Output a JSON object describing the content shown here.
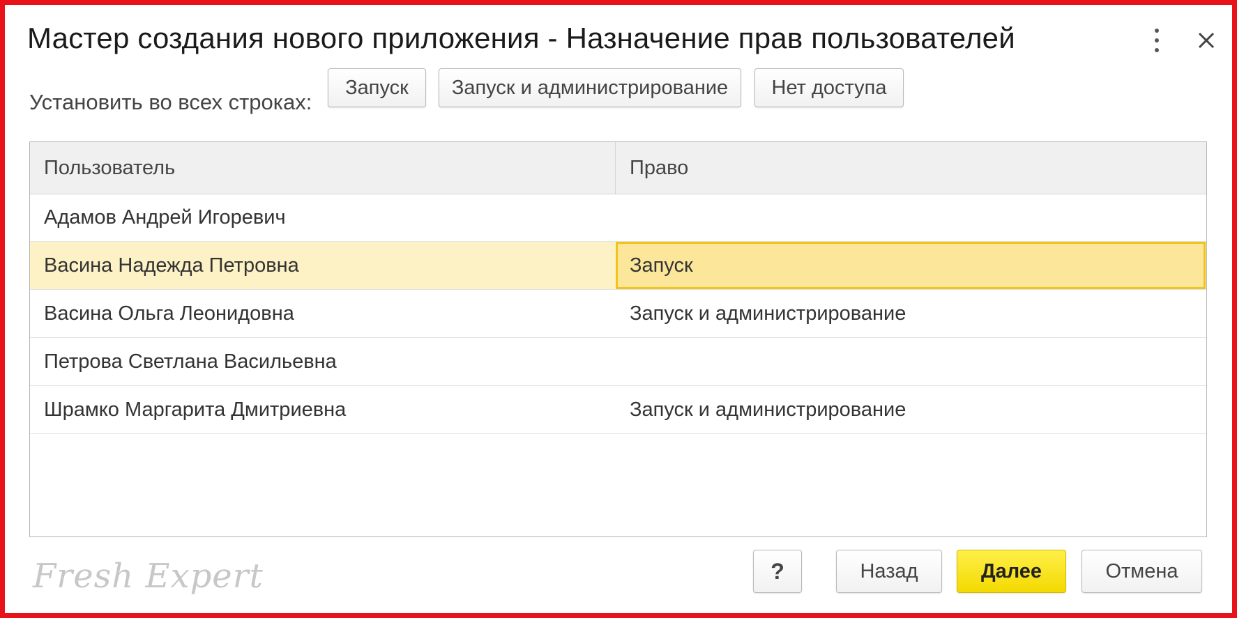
{
  "window": {
    "title": "Мастер создания нового приложения - Назначение прав пользователей",
    "more_icon": "vertical-dots-icon",
    "close_icon": "close-icon"
  },
  "toolbar": {
    "label": "Установить во всех строках:",
    "buttons": [
      {
        "label": "Запуск"
      },
      {
        "label": "Запуск и администрирование"
      },
      {
        "label": "Нет доступа"
      }
    ]
  },
  "table": {
    "columns": [
      "Пользователь",
      "Право"
    ],
    "rows": [
      {
        "user": "Адамов Андрей Игоревич",
        "right": ""
      },
      {
        "user": "Васина Надежда Петровна",
        "right": "Запуск"
      },
      {
        "user": "Васина Ольга Леонидовна",
        "right": "Запуск и администрирование"
      },
      {
        "user": "Петрова Светлана Васильевна",
        "right": ""
      },
      {
        "user": "Шрамко Маргарита Дмитриевна",
        "right": "Запуск и администрирование"
      }
    ],
    "selected_row": 1
  },
  "footer": {
    "watermark": "Fresh Expert",
    "help_label": "?",
    "back_label": "Назад",
    "next_label": "Далее",
    "cancel_label": "Отмена"
  },
  "colors": {
    "frame": "#e8121a",
    "primary_button": "#f7e000",
    "selected_row": "#fdf2c6",
    "active_cell_border": "#f2c31a"
  }
}
